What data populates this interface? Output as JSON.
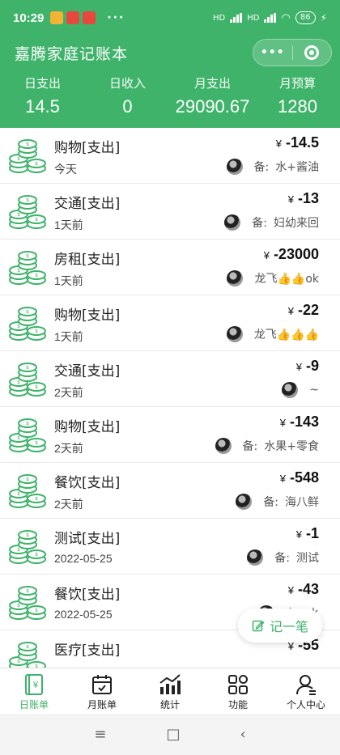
{
  "status_bar": {
    "time": "10:29",
    "network_label": "HD",
    "battery": "86",
    "dots": "···"
  },
  "app": {
    "title": "嘉腾家庭记账本",
    "capsule_more": "•••",
    "accent_color": "#3fb36a"
  },
  "stats": [
    {
      "label": "日支出",
      "value": "14.5"
    },
    {
      "label": "日收入",
      "value": "0"
    },
    {
      "label": "月支出",
      "value": "29090.67"
    },
    {
      "label": "月预算",
      "value": "1280"
    }
  ],
  "currency_symbol": "¥",
  "note_prefix": "备:",
  "records": [
    {
      "category": "购物[支出]",
      "date": "今天",
      "amount": "-14.5",
      "note": "水+酱油",
      "note_label": true
    },
    {
      "category": "交通[支出]",
      "date": "1天前",
      "amount": "-13",
      "note": "妇幼来回",
      "note_label": true
    },
    {
      "category": "房租[支出]",
      "date": "1天前",
      "amount": "-23000",
      "note": "龙飞👍👍ok",
      "note_label": false
    },
    {
      "category": "购物[支出]",
      "date": "1天前",
      "amount": "-22",
      "note": "龙飞👍👍👍",
      "note_label": false
    },
    {
      "category": "交通[支出]",
      "date": "2天前",
      "amount": "-9",
      "note": "~",
      "note_label": false
    },
    {
      "category": "购物[支出]",
      "date": "2天前",
      "amount": "-143",
      "note": "水果+零食",
      "note_label": true
    },
    {
      "category": "餐饮[支出]",
      "date": "2天前",
      "amount": "-548",
      "note": "海八鲜",
      "note_label": true
    },
    {
      "category": "测试[支出]",
      "date": "2022-05-25",
      "amount": "-1",
      "note": "测试",
      "note_label": true
    },
    {
      "category": "餐饮[支出]",
      "date": "2022-05-25",
      "amount": "-43",
      "note": "水",
      "note_label": true
    },
    {
      "category": "医疗[支出]",
      "date": "",
      "amount": "-55",
      "note": "",
      "note_label": false
    }
  ],
  "fab": {
    "label": "记一笔",
    "icon": "edit-icon"
  },
  "tabs": [
    {
      "label": "日账单",
      "icon": "daily-bill-icon",
      "active": true
    },
    {
      "label": "月账单",
      "icon": "calendar-icon",
      "active": false
    },
    {
      "label": "统计",
      "icon": "stats-chart-icon",
      "active": false
    },
    {
      "label": "功能",
      "icon": "grid-icon",
      "active": false
    },
    {
      "label": "个人中心",
      "icon": "user-icon",
      "active": false
    }
  ],
  "nav": {
    "menu": "≡",
    "home": "□",
    "back": "‹"
  }
}
